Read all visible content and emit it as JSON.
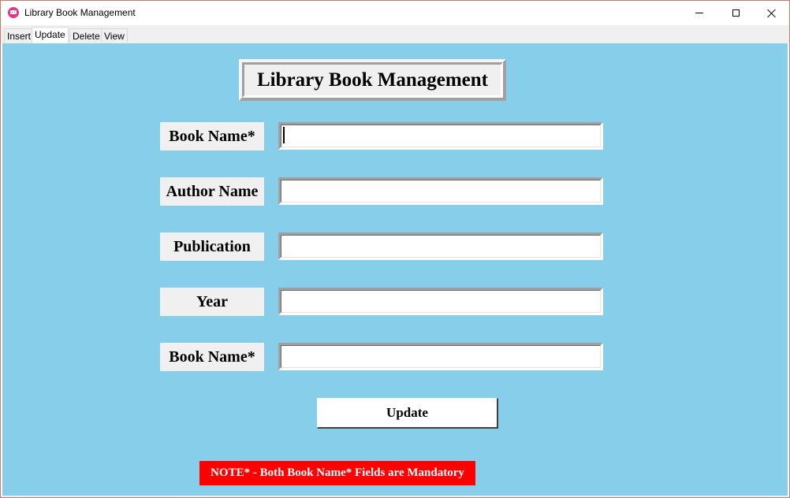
{
  "window": {
    "title": "Library Book Management",
    "icon": "app-icon"
  },
  "tabs": [
    {
      "label": "Insert",
      "active": false
    },
    {
      "label": "Update",
      "active": true
    },
    {
      "label": "Delete",
      "active": false
    },
    {
      "label": "View",
      "active": false
    }
  ],
  "form": {
    "heading": "Library Book Management",
    "fields": [
      {
        "label": "Book Name*",
        "value": ""
      },
      {
        "label": "Author Name",
        "value": ""
      },
      {
        "label": "Publication",
        "value": ""
      },
      {
        "label": "Year",
        "value": ""
      },
      {
        "label": "Book Name*",
        "value": ""
      }
    ],
    "submit_label": "Update",
    "note": "NOTE* - Both Book Name* Fields are Mandatory"
  },
  "colors": {
    "background": "#87ceeb",
    "note_background": "#ff0000",
    "label_background": "#f0f0f0"
  }
}
